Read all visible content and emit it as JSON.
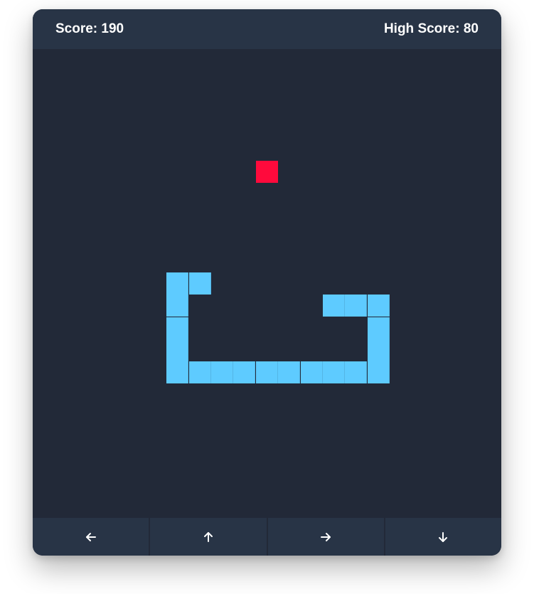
{
  "header": {
    "score_text": "Score: 190",
    "high_score_text": "High Score: 80"
  },
  "board": {
    "cols": 21,
    "rows": 21,
    "background_color": "#222938",
    "snake_color": "#5ecbff",
    "food_color": "#ff0a3c",
    "food": {
      "col": 10,
      "row": 5
    },
    "snake": [
      {
        "col": 13,
        "row": 11
      },
      {
        "col": 14,
        "row": 11
      },
      {
        "col": 15,
        "row": 11
      },
      {
        "col": 15,
        "row": 12
      },
      {
        "col": 15,
        "row": 13
      },
      {
        "col": 15,
        "row": 14
      },
      {
        "col": 14,
        "row": 14
      },
      {
        "col": 13,
        "row": 14
      },
      {
        "col": 12,
        "row": 14
      },
      {
        "col": 11,
        "row": 14
      },
      {
        "col": 10,
        "row": 14
      },
      {
        "col": 9,
        "row": 14
      },
      {
        "col": 8,
        "row": 14
      },
      {
        "col": 7,
        "row": 14
      },
      {
        "col": 6,
        "row": 14
      },
      {
        "col": 6,
        "row": 13
      },
      {
        "col": 6,
        "row": 12
      },
      {
        "col": 6,
        "row": 11
      },
      {
        "col": 6,
        "row": 10
      },
      {
        "col": 7,
        "row": 10
      }
    ]
  },
  "controls": [
    {
      "name": "left-button",
      "icon": "arrow-left-icon"
    },
    {
      "name": "up-button",
      "icon": "arrow-up-icon"
    },
    {
      "name": "right-button",
      "icon": "arrow-right-icon"
    },
    {
      "name": "down-button",
      "icon": "arrow-down-icon"
    }
  ]
}
